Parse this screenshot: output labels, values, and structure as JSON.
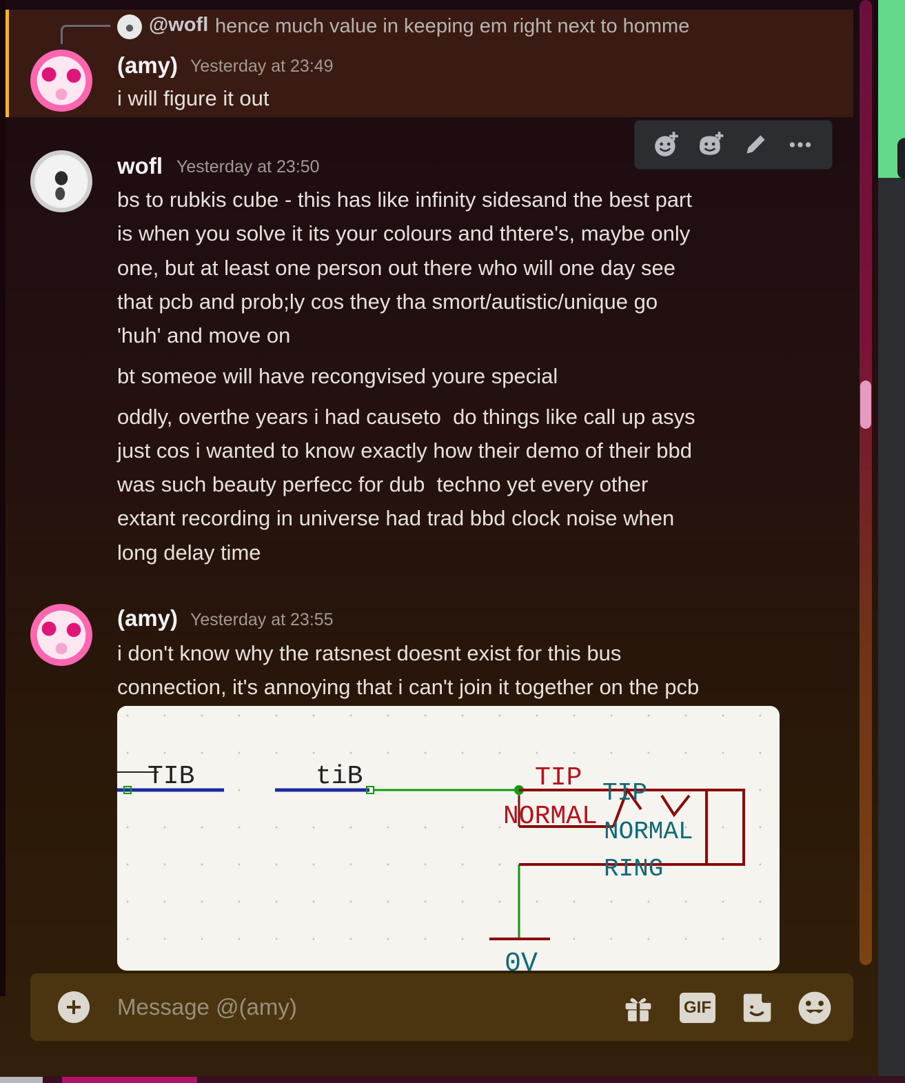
{
  "reply": {
    "mention": "@wofl",
    "text": "hence much value in keeping em right next to homme"
  },
  "messages": [
    {
      "author": "(amy)",
      "timestamp": "Yesterday at 23:49",
      "lines": [
        "i will figure it out"
      ]
    },
    {
      "author": "wofl",
      "timestamp": "Yesterday at 23:50",
      "lines": [
        "bs to rubkis cube - this has like infinity sidesand the best part",
        "is when you solve it its your colours and thtere's, maybe only",
        "one, but at least one person out there who will one day see",
        "that pcb and prob;ly cos they tha smort/autistic/unique go",
        "'huh' and move on",
        "bt someoe will have recongvised youre special",
        "oddly, overthe years i had causeto  do things like call up asys",
        "just cos i wanted to know exactly how their demo of their bbd",
        "was such beauty perfecc for dub  techno yet every other",
        "extant recording in universe had trad bbd clock noise when",
        "long delay time"
      ]
    },
    {
      "author": "(amy)",
      "timestamp": "Yesterday at 23:55",
      "lines": [
        "i don't know why the ratsnest doesnt exist for this bus",
        "connection, it's annoying that i can't join it together on the pcb"
      ]
    }
  ],
  "toolbar": {
    "icons": [
      "add-reaction-icon",
      "super-reaction-icon",
      "edit-icon",
      "more-icon"
    ]
  },
  "schematic": {
    "labels": {
      "tib_upper": "TIB",
      "tib_lower": "tiB",
      "tip": "TIP",
      "normal": "NORMAL",
      "jack_tip": "TIP",
      "jack_normal": "NORMAL",
      "jack_ring": "RING",
      "ground": "0V"
    },
    "colors": {
      "bus": "#1b2a9c",
      "wire": "#119a11",
      "label_red": "#b5121b",
      "label_teal": "#0e6a78",
      "grid_dot": "#c9c6bf"
    }
  },
  "composer": {
    "placeholder": "Message @(amy)",
    "gif_label": "GIF",
    "icons": [
      "add-attachment-icon",
      "gift-icon",
      "gif-icon",
      "sticker-icon",
      "emoji-icon"
    ]
  },
  "theme": {
    "highlight_bar": "#f0b232",
    "toolbar_bg": "#2b2d31",
    "online_green": "#64d98a"
  }
}
